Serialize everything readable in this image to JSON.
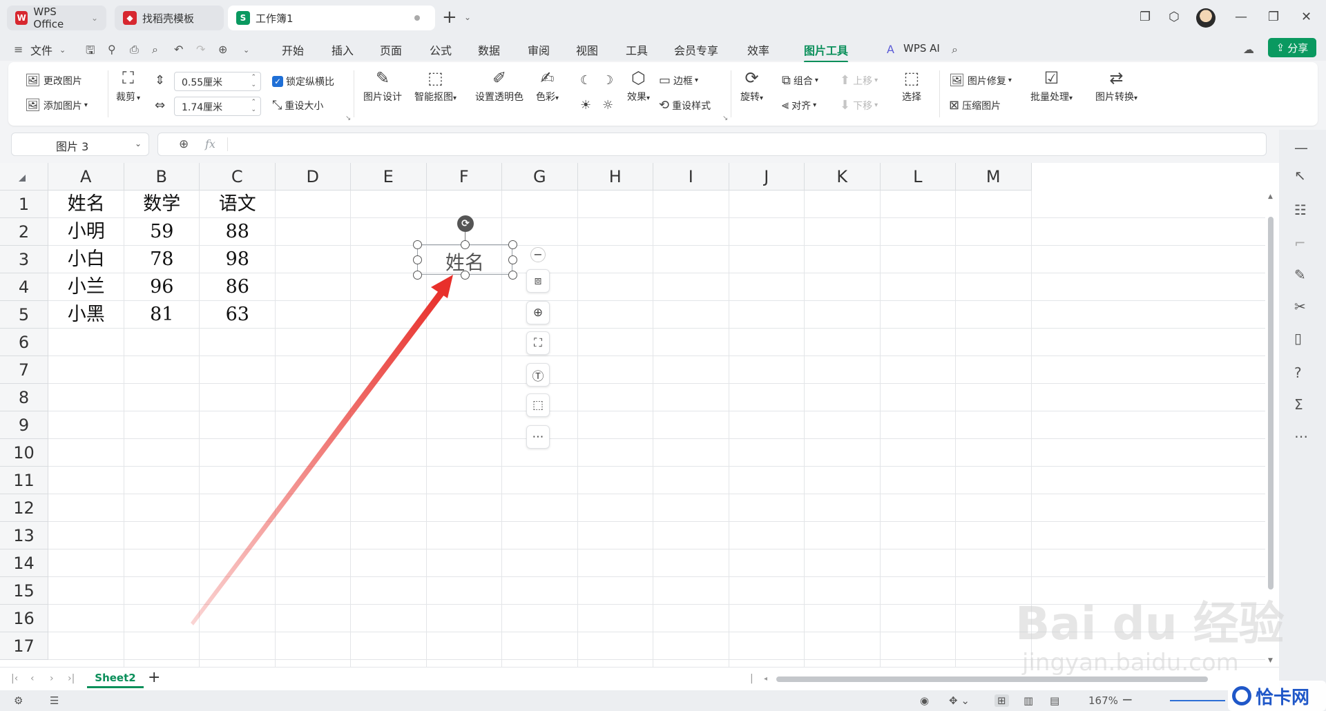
{
  "tabs": [
    {
      "label": "WPS Office",
      "logo": "W",
      "color": "#d7272f"
    },
    {
      "label": "找稻壳模板",
      "logo": "◆",
      "color": "#d7272f"
    },
    {
      "label": "工作簿1",
      "logo": "S",
      "color": "#0a9960"
    }
  ],
  "menu": {
    "file": "文件",
    "items": [
      "开始",
      "插入",
      "页面",
      "公式",
      "数据",
      "审阅",
      "视图",
      "工具",
      "会员专享",
      "效率",
      "图片工具"
    ],
    "active": "图片工具",
    "ai": "WPS AI",
    "share": "分享"
  },
  "ribbon": {
    "change_picture": "更改图片",
    "add_picture": "添加图片",
    "crop": "裁剪",
    "height_value": "0.55厘米",
    "width_value": "1.74厘米",
    "lock_ratio": "锁定纵横比",
    "reset_size": "重设大小",
    "picture_design": "图片设计",
    "smart_cutout": "智能抠图",
    "set_transparent": "设置透明色",
    "color": "色彩",
    "effects": "效果",
    "border": "边框",
    "reset_style": "重设样式",
    "rotate": "旋转",
    "group": "组合",
    "align": "对齐",
    "bring_forward": "上移",
    "send_backward": "下移",
    "select": "选择",
    "picture_repair": "图片修复",
    "compress": "压缩图片",
    "batch": "批量处理",
    "convert": "图片转换"
  },
  "formula": {
    "name_box": "图片 3",
    "fx": "fx",
    "value": ""
  },
  "columns": [
    "A",
    "B",
    "C",
    "D",
    "E",
    "F",
    "G",
    "H",
    "I",
    "J",
    "K",
    "L",
    "M"
  ],
  "rows": [
    "1",
    "2",
    "3",
    "4",
    "5",
    "6",
    "7",
    "8",
    "9",
    "10",
    "11",
    "12",
    "13",
    "14",
    "15",
    "16",
    "17"
  ],
  "table": [
    [
      "姓名",
      "数学",
      "语文"
    ],
    [
      "小明",
      "59",
      "88"
    ],
    [
      "小白",
      "78",
      "98"
    ],
    [
      "小兰",
      "96",
      "86"
    ],
    [
      "小黑",
      "81",
      "63"
    ]
  ],
  "picture_text": "姓名",
  "sheet_tab": "Sheet2",
  "status": {
    "zoom": "167%"
  },
  "watermark": {
    "main": "Bai  du 经验",
    "url": "jingyan.baidu.com",
    "corner": "恰卡网"
  },
  "colors": {
    "accent": "#0a8f5a",
    "arrow": "#e8302b"
  }
}
